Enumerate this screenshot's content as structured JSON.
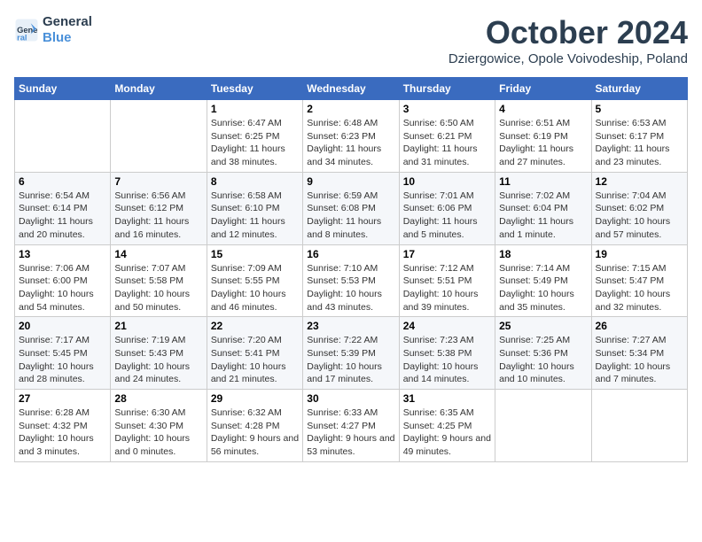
{
  "header": {
    "logo_line1": "General",
    "logo_line2": "Blue",
    "month_title": "October 2024",
    "location": "Dziergowice, Opole Voivodeship, Poland"
  },
  "weekdays": [
    "Sunday",
    "Monday",
    "Tuesday",
    "Wednesday",
    "Thursday",
    "Friday",
    "Saturday"
  ],
  "weeks": [
    [
      {
        "day": "",
        "info": ""
      },
      {
        "day": "",
        "info": ""
      },
      {
        "day": "1",
        "info": "Sunrise: 6:47 AM\nSunset: 6:25 PM\nDaylight: 11 hours and 38 minutes."
      },
      {
        "day": "2",
        "info": "Sunrise: 6:48 AM\nSunset: 6:23 PM\nDaylight: 11 hours and 34 minutes."
      },
      {
        "day": "3",
        "info": "Sunrise: 6:50 AM\nSunset: 6:21 PM\nDaylight: 11 hours and 31 minutes."
      },
      {
        "day": "4",
        "info": "Sunrise: 6:51 AM\nSunset: 6:19 PM\nDaylight: 11 hours and 27 minutes."
      },
      {
        "day": "5",
        "info": "Sunrise: 6:53 AM\nSunset: 6:17 PM\nDaylight: 11 hours and 23 minutes."
      }
    ],
    [
      {
        "day": "6",
        "info": "Sunrise: 6:54 AM\nSunset: 6:14 PM\nDaylight: 11 hours and 20 minutes."
      },
      {
        "day": "7",
        "info": "Sunrise: 6:56 AM\nSunset: 6:12 PM\nDaylight: 11 hours and 16 minutes."
      },
      {
        "day": "8",
        "info": "Sunrise: 6:58 AM\nSunset: 6:10 PM\nDaylight: 11 hours and 12 minutes."
      },
      {
        "day": "9",
        "info": "Sunrise: 6:59 AM\nSunset: 6:08 PM\nDaylight: 11 hours and 8 minutes."
      },
      {
        "day": "10",
        "info": "Sunrise: 7:01 AM\nSunset: 6:06 PM\nDaylight: 11 hours and 5 minutes."
      },
      {
        "day": "11",
        "info": "Sunrise: 7:02 AM\nSunset: 6:04 PM\nDaylight: 11 hours and 1 minute."
      },
      {
        "day": "12",
        "info": "Sunrise: 7:04 AM\nSunset: 6:02 PM\nDaylight: 10 hours and 57 minutes."
      }
    ],
    [
      {
        "day": "13",
        "info": "Sunrise: 7:06 AM\nSunset: 6:00 PM\nDaylight: 10 hours and 54 minutes."
      },
      {
        "day": "14",
        "info": "Sunrise: 7:07 AM\nSunset: 5:58 PM\nDaylight: 10 hours and 50 minutes."
      },
      {
        "day": "15",
        "info": "Sunrise: 7:09 AM\nSunset: 5:55 PM\nDaylight: 10 hours and 46 minutes."
      },
      {
        "day": "16",
        "info": "Sunrise: 7:10 AM\nSunset: 5:53 PM\nDaylight: 10 hours and 43 minutes."
      },
      {
        "day": "17",
        "info": "Sunrise: 7:12 AM\nSunset: 5:51 PM\nDaylight: 10 hours and 39 minutes."
      },
      {
        "day": "18",
        "info": "Sunrise: 7:14 AM\nSunset: 5:49 PM\nDaylight: 10 hours and 35 minutes."
      },
      {
        "day": "19",
        "info": "Sunrise: 7:15 AM\nSunset: 5:47 PM\nDaylight: 10 hours and 32 minutes."
      }
    ],
    [
      {
        "day": "20",
        "info": "Sunrise: 7:17 AM\nSunset: 5:45 PM\nDaylight: 10 hours and 28 minutes."
      },
      {
        "day": "21",
        "info": "Sunrise: 7:19 AM\nSunset: 5:43 PM\nDaylight: 10 hours and 24 minutes."
      },
      {
        "day": "22",
        "info": "Sunrise: 7:20 AM\nSunset: 5:41 PM\nDaylight: 10 hours and 21 minutes."
      },
      {
        "day": "23",
        "info": "Sunrise: 7:22 AM\nSunset: 5:39 PM\nDaylight: 10 hours and 17 minutes."
      },
      {
        "day": "24",
        "info": "Sunrise: 7:23 AM\nSunset: 5:38 PM\nDaylight: 10 hours and 14 minutes."
      },
      {
        "day": "25",
        "info": "Sunrise: 7:25 AM\nSunset: 5:36 PM\nDaylight: 10 hours and 10 minutes."
      },
      {
        "day": "26",
        "info": "Sunrise: 7:27 AM\nSunset: 5:34 PM\nDaylight: 10 hours and 7 minutes."
      }
    ],
    [
      {
        "day": "27",
        "info": "Sunrise: 6:28 AM\nSunset: 4:32 PM\nDaylight: 10 hours and 3 minutes."
      },
      {
        "day": "28",
        "info": "Sunrise: 6:30 AM\nSunset: 4:30 PM\nDaylight: 10 hours and 0 minutes."
      },
      {
        "day": "29",
        "info": "Sunrise: 6:32 AM\nSunset: 4:28 PM\nDaylight: 9 hours and 56 minutes."
      },
      {
        "day": "30",
        "info": "Sunrise: 6:33 AM\nSunset: 4:27 PM\nDaylight: 9 hours and 53 minutes."
      },
      {
        "day": "31",
        "info": "Sunrise: 6:35 AM\nSunset: 4:25 PM\nDaylight: 9 hours and 49 minutes."
      },
      {
        "day": "",
        "info": ""
      },
      {
        "day": "",
        "info": ""
      }
    ]
  ]
}
